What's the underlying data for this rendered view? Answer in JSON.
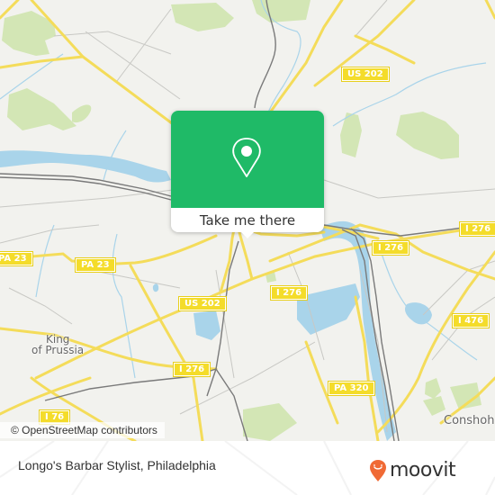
{
  "map": {
    "road_shields": [
      {
        "label": "US 202",
        "pos": "top-right"
      },
      {
        "label": "PA 23",
        "pos": "left-edge"
      },
      {
        "label": "PA 23",
        "pos": "center-left"
      },
      {
        "label": "US 202",
        "pos": "center"
      },
      {
        "label": "I 276",
        "pos": "center"
      },
      {
        "label": "I 276",
        "pos": "center-right"
      },
      {
        "label": "I 276",
        "pos": "right-edge"
      },
      {
        "label": "I 276",
        "pos": "lower-center"
      },
      {
        "label": "I 476",
        "pos": "right"
      },
      {
        "label": "PA 320",
        "pos": "lower-right"
      },
      {
        "label": "I 76",
        "pos": "bottom-left"
      }
    ],
    "places": [
      {
        "label": "King"
      },
      {
        "label": "of Prussia"
      },
      {
        "label": "Conshoh"
      }
    ],
    "attribution": "© OpenStreetMap contributors",
    "colors": {
      "land": "#f2f2ee",
      "water": "#a9d4ea",
      "park": "#d3e6b5",
      "road": "#f4dc5a",
      "minor_road": "#c8c8c4",
      "rail": "#7a7a7a"
    }
  },
  "popup": {
    "icon": "map-pin-icon",
    "button_label": "Take me there",
    "color": "#1fba67"
  },
  "footer": {
    "title": "Longo's Barbar Stylist, Philadelphia",
    "brand": "moovit",
    "brand_color": "#f06a35"
  }
}
